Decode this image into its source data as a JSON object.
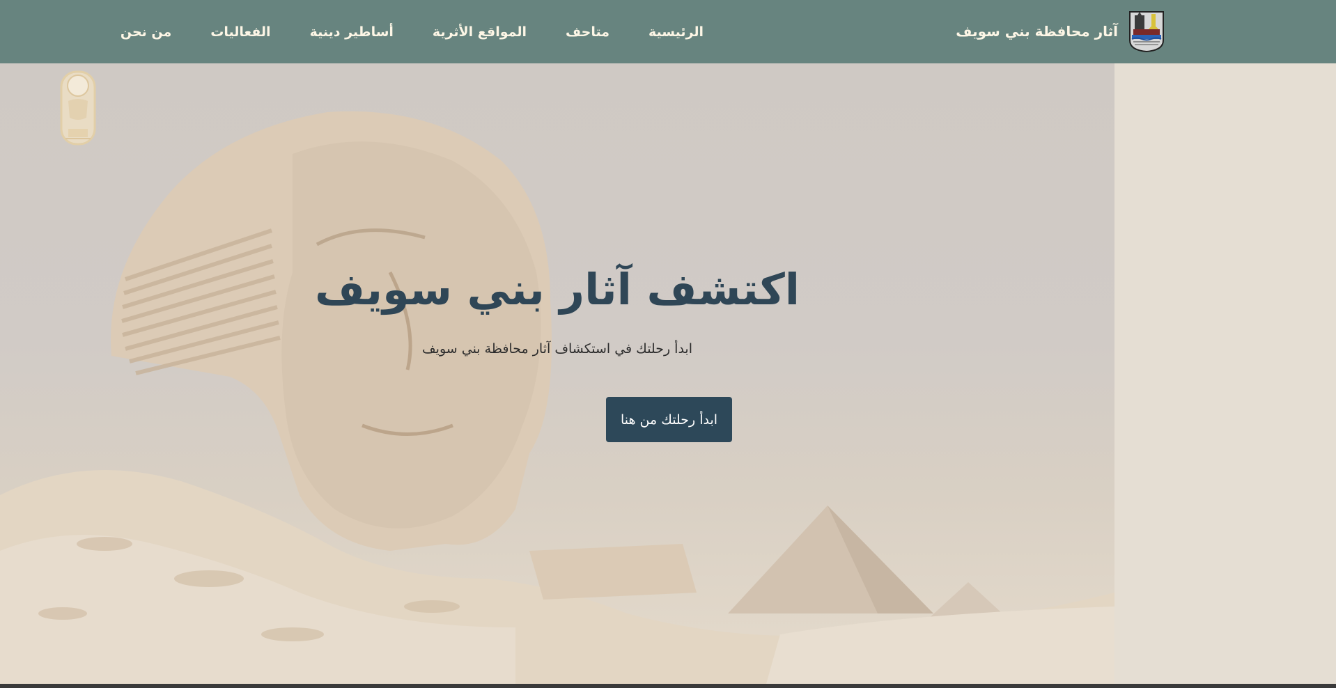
{
  "navbar": {
    "brand_title": "آثار محافظة بني سويف",
    "logo_icon": "governorate-seal-icon",
    "links": [
      {
        "label": "الرئيسية"
      },
      {
        "label": "متاحف"
      },
      {
        "label": "المواقع الأثرية"
      },
      {
        "label": "أساطير دينية"
      },
      {
        "label": "الفعاليات"
      },
      {
        "label": "من نحن"
      }
    ]
  },
  "hero": {
    "title": "اكتشف آثار بني سويف",
    "subtitle": "ابدأ رحلتك في استكشاف آثار محافظة بني سويف",
    "cta_label": "ابدأ رحلتك من هنا",
    "background_icon": "sphinx-pyramid-image",
    "emblem_icon": "pharaonic-emblem-icon"
  },
  "colors": {
    "navbar_bg": "#67847f",
    "nav_text": "#fdf6e6",
    "title_text": "#2f4656",
    "button_bg": "#2d4859",
    "page_bg": "#e5ded3"
  }
}
